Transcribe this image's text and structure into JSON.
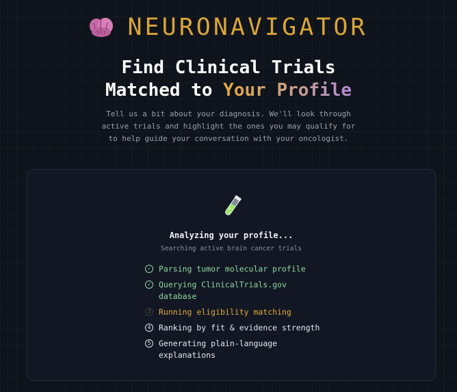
{
  "brand": {
    "name": "NEURONAVIGATOR",
    "logo_icon": "brain-icon",
    "color": "#d9a53a"
  },
  "hero": {
    "title_line1": "Find Clinical Trials",
    "title_line2_prefix": "Matched to ",
    "title_line2_highlight": "Your Profile",
    "subtitle_lines": [
      "Tell us a bit about your diagnosis. We'll look through",
      "active trials and highlight the ones you may qualify for",
      "to help guide your conversation with your oncologist."
    ]
  },
  "progress": {
    "icon": "test-tube-icon",
    "title": "Analyzing your profile...",
    "subtitle": "Searching active brain cancer trials",
    "steps": [
      {
        "marker": "✓",
        "lines": [
          "Parsing tumor molecular profile"
        ],
        "state": "done"
      },
      {
        "marker": "✓",
        "lines": [
          "Querying ClinicalTrials.gov",
          "database"
        ],
        "state": "done"
      },
      {
        "marker": "3",
        "lines": [
          "Running eligibility matching"
        ],
        "state": "active"
      },
      {
        "marker": "4",
        "lines": [
          "Ranking by fit & evidence strength"
        ],
        "state": "pending"
      },
      {
        "marker": "5",
        "lines": [
          "Generating plain-language",
          "explanations"
        ],
        "state": "pending"
      }
    ]
  },
  "colors": {
    "background": "#0f131b",
    "done": "#8fd7a0",
    "active": "#e0a93a",
    "pending": "#e6e8ee"
  }
}
